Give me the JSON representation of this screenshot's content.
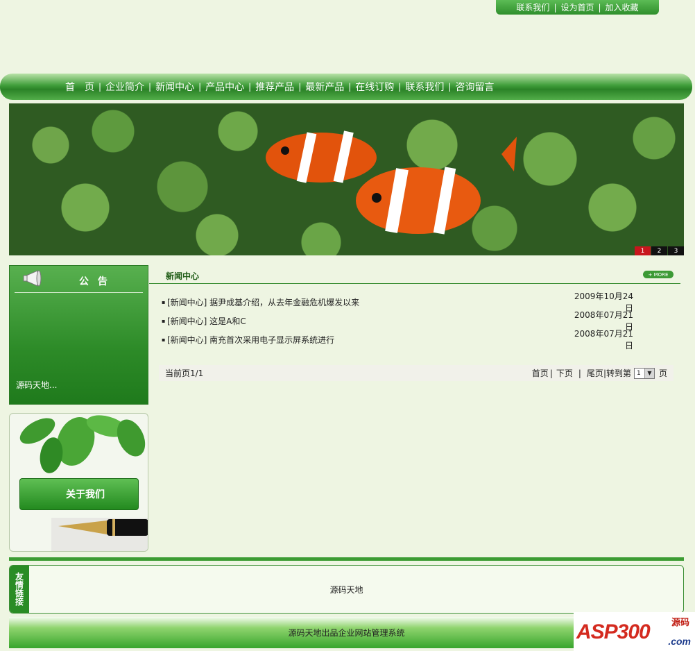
{
  "top_links": [
    "联系我们",
    "设为首页",
    "加入收藏"
  ],
  "top_sep": "|",
  "nav": {
    "items": [
      "首　页",
      "企业简介",
      "新闻中心",
      "产品中心",
      "推荐产品",
      "最新产品",
      "在线订购",
      "联系我们",
      "咨询留言"
    ],
    "sep": "|"
  },
  "banner": {
    "pages": [
      "1",
      "2",
      "3"
    ],
    "active_page": "1"
  },
  "notice": {
    "title": "公 告",
    "text": "源码天地..."
  },
  "about": {
    "button_label": "关于我们"
  },
  "news": {
    "title": "新闻中心",
    "more_label": "+ MORE",
    "items": [
      {
        "bullet": "▪",
        "title": "[新闻中心] 据尹成基介绍，从去年金融危机爆发以来",
        "date": "2009年10月24日"
      },
      {
        "bullet": "▪",
        "title": "[新闻中心] 这是A和C",
        "date": "2008年07月21日"
      },
      {
        "bullet": "▪",
        "title": "[新闻中心] 南充首次采用电子显示屏系统进行",
        "date": "2008年07月21日"
      }
    ]
  },
  "pager": {
    "current": "当前页1/1",
    "first": "首页",
    "next": "下页",
    "last": "尾页",
    "goto": "|转到第",
    "page_value": "1",
    "page_suffix": "页",
    "sep": "|"
  },
  "friend_links": {
    "tab_chars": [
      "友",
      "情",
      "链",
      "接"
    ],
    "link": "源码天地"
  },
  "footer": {
    "text": "源码天地出品企业网站管理系统"
  },
  "watermark": {
    "asp": "ASP300",
    "src": "源码",
    "com": ".com"
  },
  "colors": {
    "primary_green": "#2d8b28",
    "bg": "#eef5e2",
    "pager_active": "#c8161d"
  }
}
